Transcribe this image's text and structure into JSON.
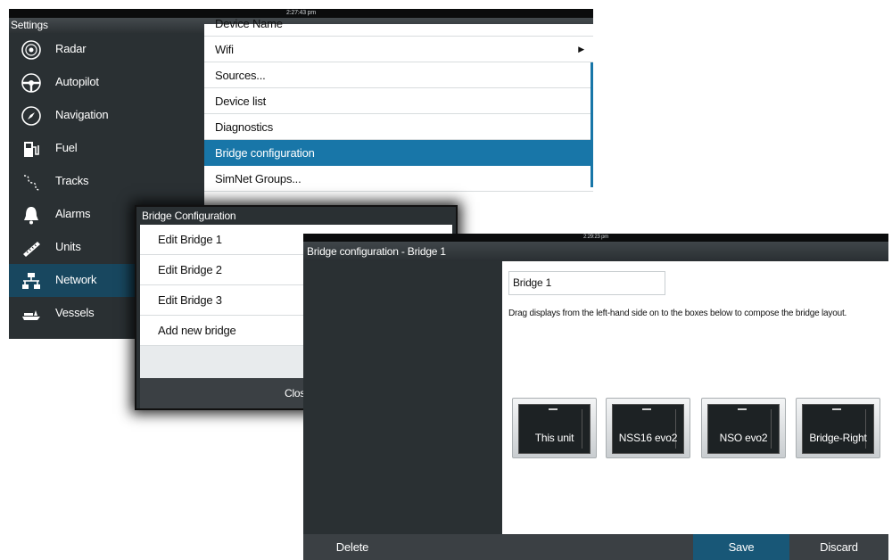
{
  "settings": {
    "time": "2:27:43 pm",
    "title": "Settings",
    "sidebar": [
      {
        "label": "Radar",
        "icon": "radar-icon"
      },
      {
        "label": "Autopilot",
        "icon": "autopilot-icon"
      },
      {
        "label": "Navigation",
        "icon": "navigation-icon"
      },
      {
        "label": "Fuel",
        "icon": "fuel-icon"
      },
      {
        "label": "Tracks",
        "icon": "tracks-icon"
      },
      {
        "label": "Alarms",
        "icon": "alarms-icon"
      },
      {
        "label": "Units",
        "icon": "units-icon"
      },
      {
        "label": "Network",
        "icon": "network-icon",
        "active": true
      },
      {
        "label": "Vessels",
        "icon": "vessels-icon"
      }
    ],
    "menu": [
      "Device Name",
      "Wifi",
      "Sources...",
      "Device list",
      "Diagnostics",
      "Bridge configuration",
      "SimNet Groups..."
    ],
    "selected_menu": "Bridge configuration"
  },
  "dialog": {
    "title": "Bridge Configuration",
    "items": [
      "Edit Bridge 1",
      "Edit Bridge 2",
      "Edit Bridge 3",
      "Add new bridge"
    ],
    "close_label": "Close"
  },
  "bridge": {
    "time": "2:29:23 pm",
    "title": "Bridge configuration - Bridge 1",
    "name_value": "Bridge 1",
    "instruction": "Drag displays from the left-hand side on to the boxes below to compose the bridge layout.",
    "units": [
      "This unit",
      "NSS16 evo2",
      "NSO evo2",
      "Bridge-Right"
    ],
    "footer": {
      "delete": "Delete",
      "save": "Save",
      "discard": "Discard"
    }
  },
  "colors": {
    "accent": "#1876a8",
    "active_sidebar": "#18475f",
    "panel": "#2a3033"
  }
}
